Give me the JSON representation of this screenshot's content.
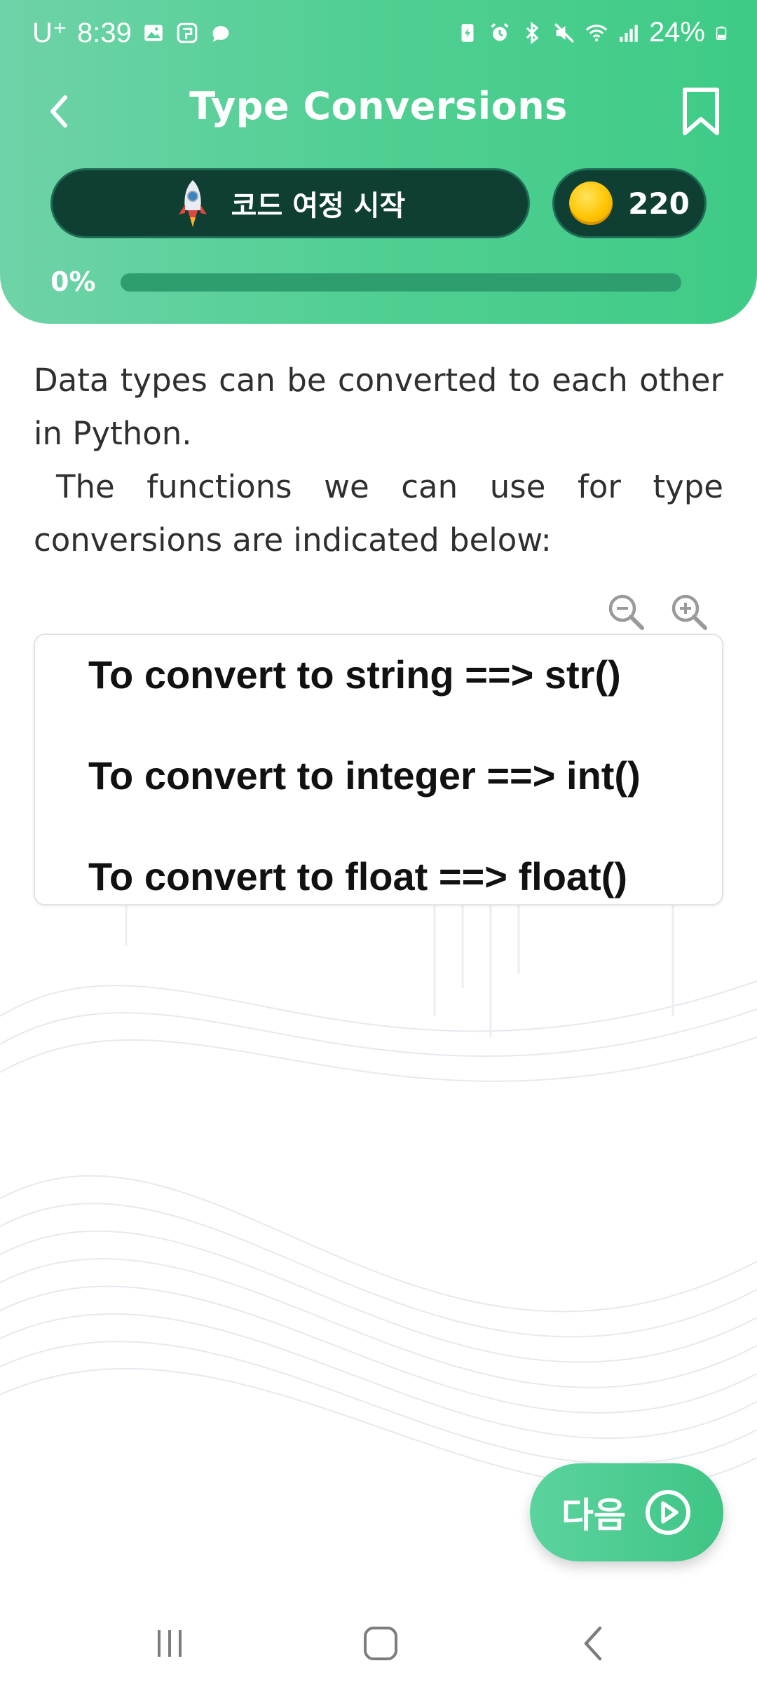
{
  "status_bar": {
    "carrier": "U⁺",
    "time": "8:39",
    "battery": "24%"
  },
  "header": {
    "title": "Type Conversions",
    "journey_label": "코드 여정 시작",
    "coins": "220",
    "progress_label": "0%",
    "progress_value": 0
  },
  "content": {
    "paragraph_line1": "Data types can be converted to each other in Python.",
    "paragraph_line2": "The functions we can use for type conversions are indicated below:",
    "code_lines": [
      "To convert to string ==> str()",
      "To convert to integer ==> int()",
      "To convert to float ==> float()"
    ]
  },
  "footer": {
    "next_label": "다음"
  },
  "icons": {
    "back": "back-arrow-icon",
    "bookmark": "bookmark-icon",
    "rocket": "rocket-icon",
    "coin": "coin-icon",
    "zoom_out": "zoom-out-icon",
    "zoom_in": "zoom-in-icon",
    "next": "play-circle-icon"
  },
  "colors": {
    "header_green": "#4ccd8f",
    "dark_pill": "#0f3f33",
    "coin_gold": "#ffc400"
  }
}
